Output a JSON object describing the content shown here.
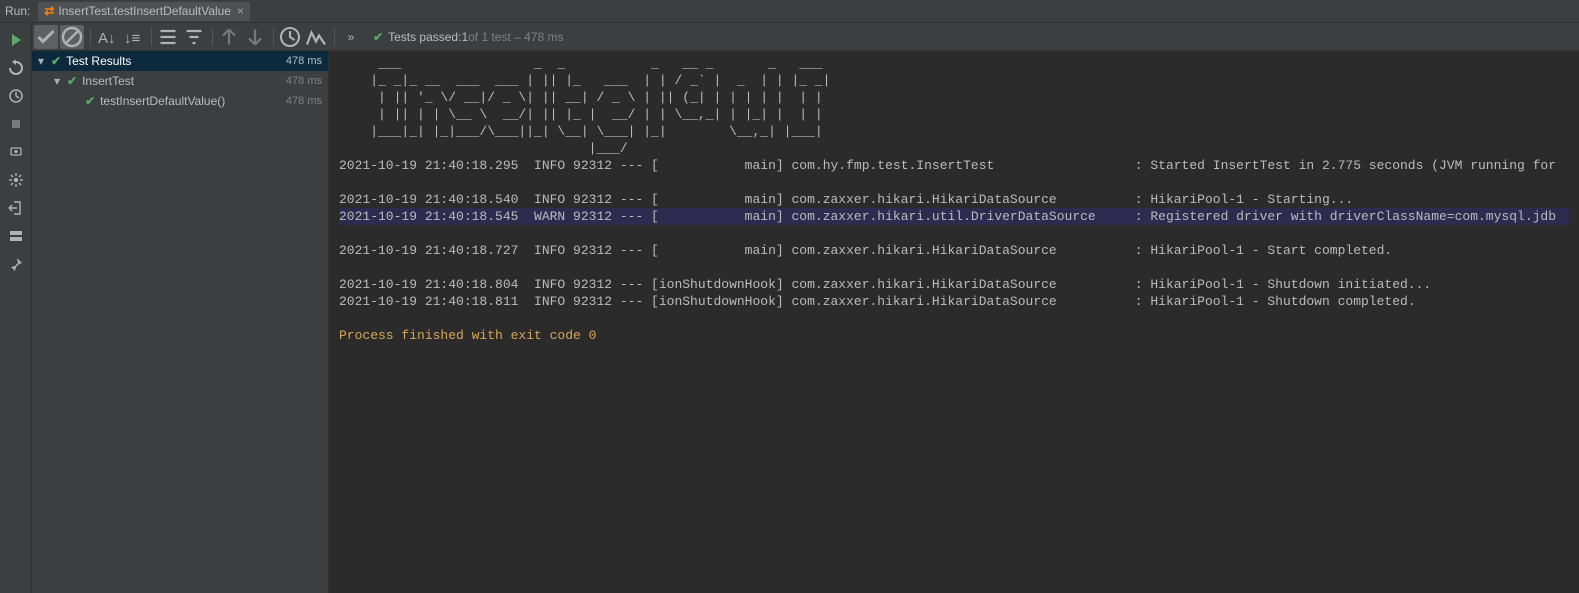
{
  "header": {
    "run_label": "Run:",
    "tab_name": "InsertTest.testInsertDefaultValue"
  },
  "status": {
    "passed_prefix": "Tests passed: ",
    "passed_count": "1",
    "passed_suffix": " of 1 test – 478 ms"
  },
  "tree": {
    "root": {
      "label": "Test Results",
      "time": "478 ms"
    },
    "suite": {
      "label": "InsertTest",
      "time": "478 ms"
    },
    "test": {
      "label": "testInsertDefaultValue()",
      "time": "478 ms"
    }
  },
  "console": {
    "banner": "     ___                 _  _           _   __ _       _   ___\n    |_ _|_ __  ___  ___ | || |_   ___  | | / _` |  _  | | |_ _|\n     | || '_ \\/ __|/ _ \\| || __| / _ \\ | || (_| | | | | |  | |\n     | || | | \\__ \\  __/| || |_ |  __/ | | \\__,_| | |_| |  | |\n    |___|_| |_|___/\\___||_| \\__| \\___| |_|        \\__,_| |___|\n                                |___/",
    "lines": [
      {
        "ts": "2021-10-19 21:40:18.295",
        "lvl": "INFO",
        "pid": "92312",
        "thr": "           main",
        "cls": "com.hy.fmp.test.InsertTest                 ",
        "msg": "Started InsertTest in 2.775 seconds (JVM running for",
        "warn": false
      },
      {
        "blank": true
      },
      {
        "ts": "2021-10-19 21:40:18.540",
        "lvl": "INFO",
        "pid": "92312",
        "thr": "           main",
        "cls": "com.zaxxer.hikari.HikariDataSource         ",
        "msg": "HikariPool-1 - Starting...",
        "warn": false
      },
      {
        "ts": "2021-10-19 21:40:18.545",
        "lvl": "WARN",
        "pid": "92312",
        "thr": "           main",
        "cls": "com.zaxxer.hikari.util.DriverDataSource    ",
        "msg": "Registered driver with driverClassName=com.mysql.jdb",
        "warn": true
      },
      {
        "ts": "2021-10-19 21:40:18.727",
        "lvl": "INFO",
        "pid": "92312",
        "thr": "           main",
        "cls": "com.zaxxer.hikari.HikariDataSource         ",
        "msg": "HikariPool-1 - Start completed.",
        "warn": false
      },
      {
        "blank": true
      },
      {
        "ts": "2021-10-19 21:40:18.804",
        "lvl": "INFO",
        "pid": "92312",
        "thr": "ionShutdownHook",
        "cls": "com.zaxxer.hikari.HikariDataSource         ",
        "msg": "HikariPool-1 - Shutdown initiated...",
        "warn": false
      },
      {
        "ts": "2021-10-19 21:40:18.811",
        "lvl": "INFO",
        "pid": "92312",
        "thr": "ionShutdownHook",
        "cls": "com.zaxxer.hikari.HikariDataSource         ",
        "msg": "HikariPool-1 - Shutdown completed.",
        "warn": false
      }
    ],
    "exit_line": "Process finished with exit code 0"
  }
}
